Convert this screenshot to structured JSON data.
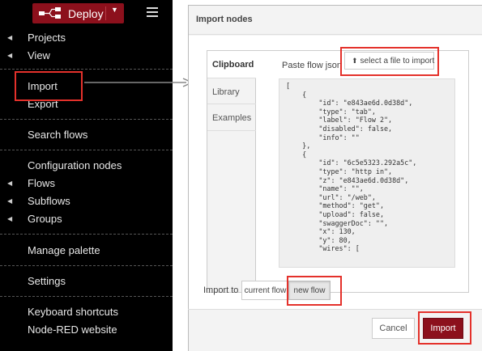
{
  "menu": {
    "deploy_label": "Deploy",
    "items": {
      "projects": "Projects",
      "view": "View",
      "import": "Import",
      "export": "Export",
      "search_flows": "Search flows",
      "configuration_nodes": "Configuration nodes",
      "flows": "Flows",
      "subflows": "Subflows",
      "groups": "Groups",
      "manage_palette": "Manage palette",
      "settings": "Settings",
      "keyboard_shortcuts": "Keyboard shortcuts",
      "node_red_website": "Node-RED website"
    }
  },
  "dialog": {
    "title": "Import nodes",
    "tabs": [
      "Clipboard",
      "Library",
      "Examples"
    ],
    "paste_label": "Paste flow json or",
    "select_file_label": "select a file to import",
    "json_text": "[\n    {\n        \"id\": \"e843ae6d.0d38d\",\n        \"type\": \"tab\",\n        \"label\": \"Flow 2\",\n        \"disabled\": false,\n        \"info\": \"\"\n    },\n    {\n        \"id\": \"6c5e5323.292a5c\",\n        \"type\": \"http in\",\n        \"z\": \"e843ae6d.0d38d\",\n        \"name\": \"\",\n        \"url\": \"/web\",\n        \"method\": \"get\",\n        \"upload\": false,\n        \"swaggerDoc\": \"\",\n        \"x\": 130,\n        \"y\": 80,\n        \"wires\": [",
    "import_to_label": "Import to",
    "import_to_options": {
      "current": "current flow",
      "new": "new flow"
    },
    "import_to_selected": "new flow",
    "cancel_label": "Cancel",
    "import_label": "Import"
  },
  "colors": {
    "accent": "#8c101c",
    "highlight": "#e4312b",
    "menu_bg": "#000000"
  }
}
